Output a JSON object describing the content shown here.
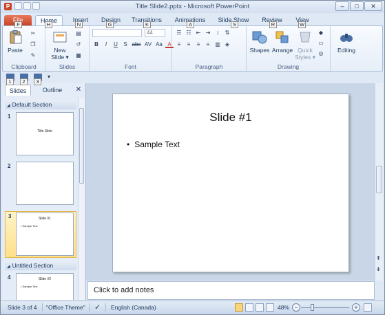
{
  "window": {
    "title": "Title Slide2.pptx - Microsoft PowerPoint",
    "app_icon": "P",
    "controls": [
      "–",
      "□",
      "✕"
    ]
  },
  "ribbon_tabs": [
    {
      "label": "File",
      "keytip": "F"
    },
    {
      "label": "Home",
      "keytip": "H"
    },
    {
      "label": "Insert",
      "keytip": "N"
    },
    {
      "label": "Design",
      "keytip": "G"
    },
    {
      "label": "Transitions",
      "keytip": "K"
    },
    {
      "label": "Animations",
      "keytip": "A"
    },
    {
      "label": "Slide Show",
      "keytip": "S"
    },
    {
      "label": "Review",
      "keytip": "R"
    },
    {
      "label": "View",
      "keytip": "W"
    }
  ],
  "ribbon": {
    "clipboard": {
      "label": "Clipboard",
      "paste": "Paste"
    },
    "slides": {
      "label": "Slides",
      "new_slide": "New Slide ▾"
    },
    "font": {
      "label": "Font",
      "size_value": "44",
      "buttons": [
        "B",
        "I",
        "U",
        "S",
        "abc",
        "AV",
        "Aa",
        "A"
      ]
    },
    "paragraph": {
      "label": "Paragraph"
    },
    "drawing": {
      "label": "Drawing",
      "shapes": "Shapes",
      "arrange": "Arrange",
      "quick_styles": "Quick Styles ▾"
    },
    "editing": {
      "label": "Editing"
    }
  },
  "qat_keytips": [
    "1",
    "2",
    "3"
  ],
  "left_pane": {
    "tabs": {
      "slides": "Slides",
      "outline": "Outline",
      "close": "✕"
    },
    "sections": [
      {
        "title": "Default Section"
      },
      {
        "title": "Untitled Section"
      }
    ],
    "slides": [
      {
        "num": "1",
        "title": "Title Slide",
        "body": ""
      },
      {
        "num": "2",
        "title": "",
        "body": ""
      },
      {
        "num": "3",
        "title": "Slide #1",
        "body": "• Sample Text"
      },
      {
        "num": "4",
        "title": "Slide #2",
        "body": "• Sample Text"
      }
    ],
    "selected_slide": "3"
  },
  "main_slide": {
    "title": "Slide #1",
    "bullet": "Sample Text"
  },
  "notes": {
    "placeholder": "Click to add notes"
  },
  "statusbar": {
    "slide_info": "Slide 3 of 4",
    "theme": "\"Office Theme\"",
    "language": "English (Canada)",
    "zoom": "48%",
    "zoom_percent": 48
  }
}
